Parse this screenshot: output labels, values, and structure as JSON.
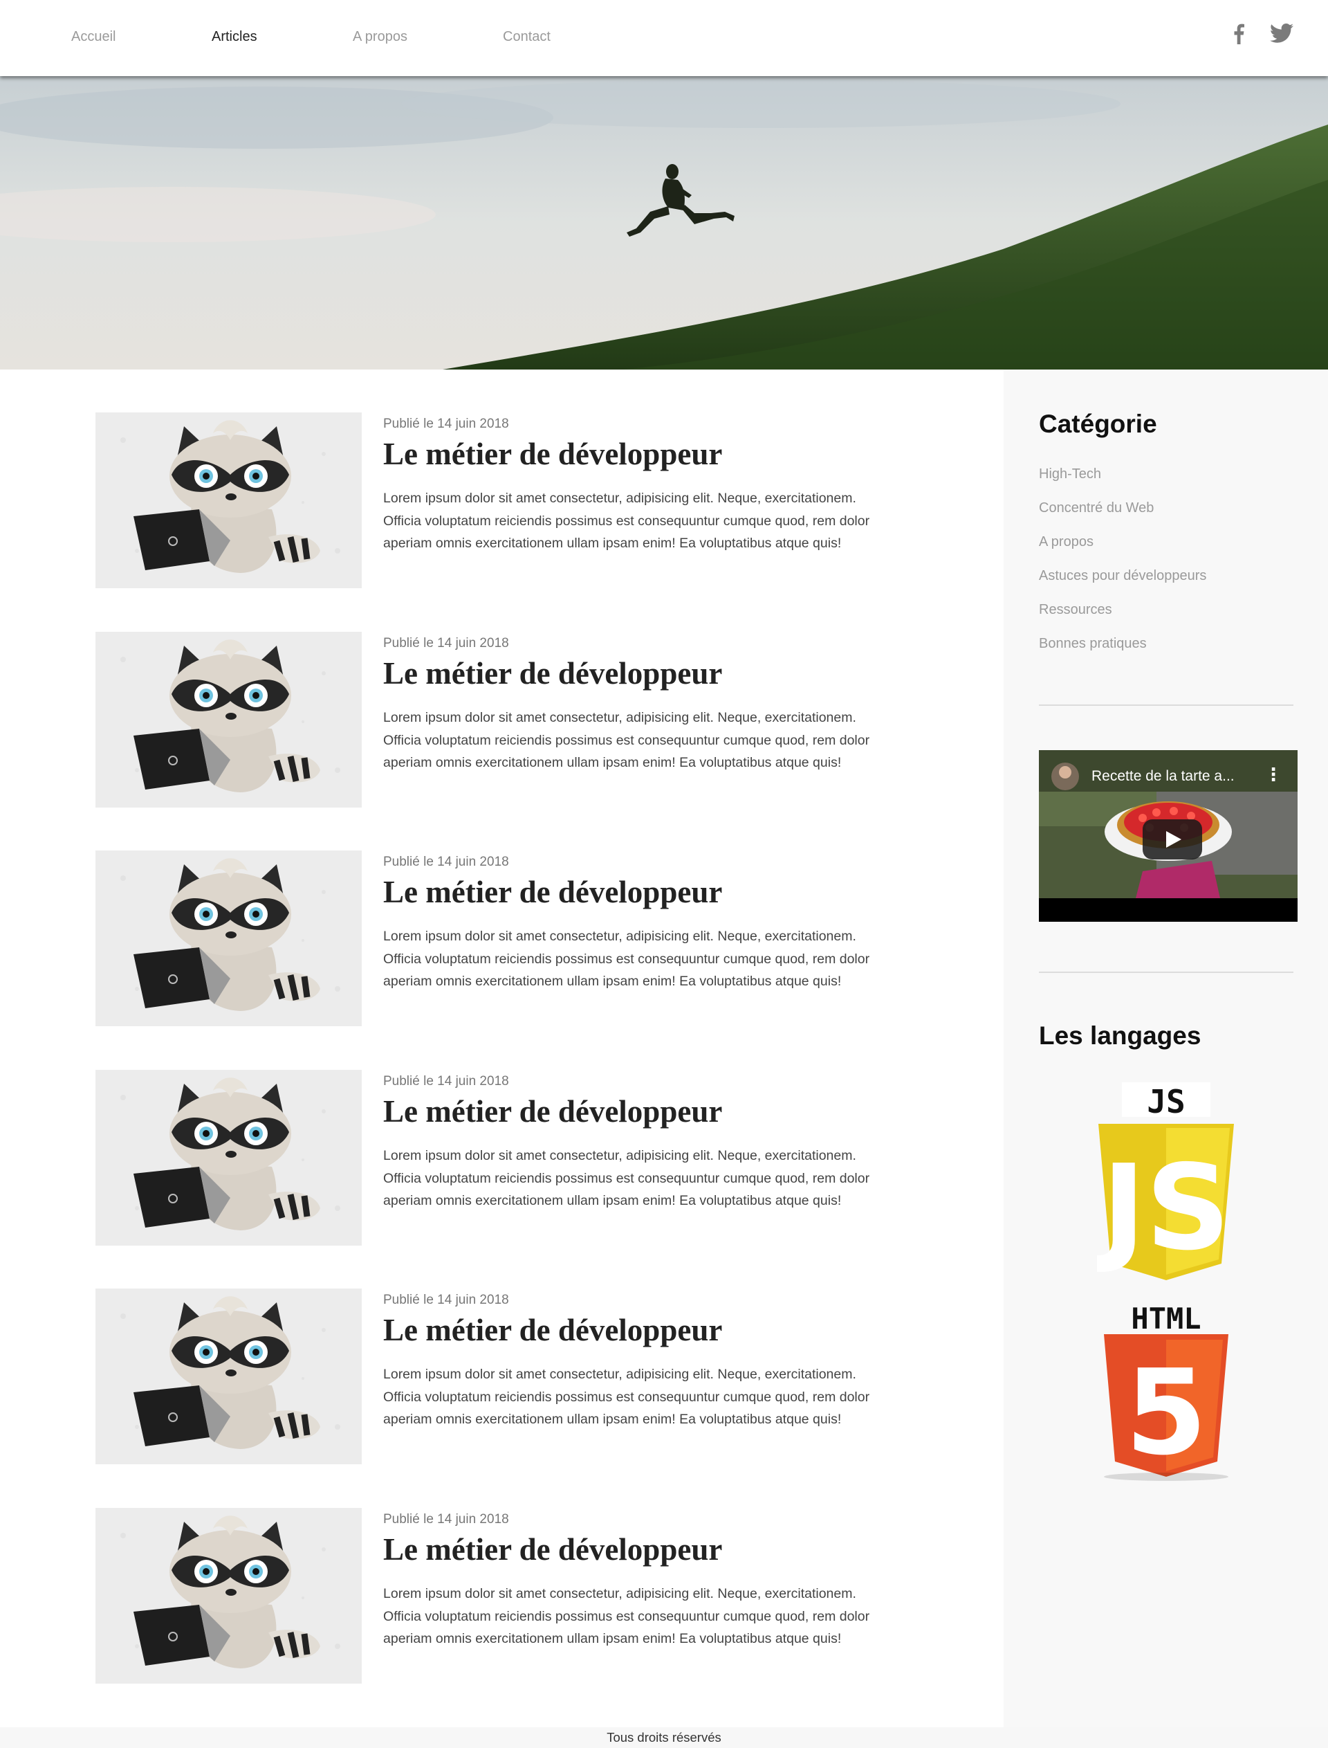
{
  "nav": {
    "items": [
      {
        "label": "Accueil",
        "active": false
      },
      {
        "label": "Articles",
        "active": true
      },
      {
        "label": "A propos",
        "active": false
      },
      {
        "label": "Contact",
        "active": false
      }
    ],
    "social": [
      "facebook-icon",
      "twitter-icon"
    ]
  },
  "hero": {
    "image": "person-jumping-on-grassy-hill"
  },
  "articles": [
    {
      "meta": "Publié le 14 juin 2018",
      "title": "Le métier de développeur",
      "lines": [
        "Lorem ipsum dolor sit amet consectetur, adipisicing elit. Neque, exercitationem.",
        "Officia voluptatum reiciendis possimus est consequuntur cumque quod, rem dolor",
        "aperiam omnis exercitationem ullam ipsam enim! Ea voluptatibus atque quis!"
      ]
    },
    {
      "meta": "Publié le 14 juin 2018",
      "title": "Le métier de développeur",
      "lines": [
        "Lorem ipsum dolor sit amet consectetur, adipisicing elit. Neque, exercitationem.",
        "Officia voluptatum reiciendis possimus est consequuntur cumque quod, rem dolor",
        "aperiam omnis exercitationem ullam ipsam enim! Ea voluptatibus atque quis!"
      ]
    },
    {
      "meta": "Publié le 14 juin 2018",
      "title": "Le métier de développeur",
      "lines": [
        "Lorem ipsum dolor sit amet consectetur, adipisicing elit. Neque, exercitationem.",
        "Officia voluptatum reiciendis possimus est consequuntur cumque quod, rem dolor",
        "aperiam omnis exercitationem ullam ipsam enim! Ea voluptatibus atque quis!"
      ]
    },
    {
      "meta": "Publié le 14 juin 2018",
      "title": "Le métier de développeur",
      "lines": [
        "Lorem ipsum dolor sit amet consectetur, adipisicing elit. Neque, exercitationem.",
        "Officia voluptatum reiciendis possimus est consequuntur cumque quod, rem dolor",
        "aperiam omnis exercitationem ullam ipsam enim! Ea voluptatibus atque quis!"
      ]
    },
    {
      "meta": "Publié le 14 juin 2018",
      "title": "Le métier de développeur",
      "lines": [
        "Lorem ipsum dolor sit amet consectetur, adipisicing elit. Neque, exercitationem.",
        "Officia voluptatum reiciendis possimus est consequuntur cumque quod, rem dolor",
        "aperiam omnis exercitationem ullam ipsam enim! Ea voluptatibus atque quis!"
      ]
    },
    {
      "meta": "Publié le 14 juin 2018",
      "title": "Le métier de développeur",
      "lines": [
        "Lorem ipsum dolor sit amet consectetur, adipisicing elit. Neque, exercitationem.",
        "Officia voluptatum reiciendis possimus est consequuntur cumque quod, rem dolor",
        "aperiam omnis exercitationem ullam ipsam enim! Ea voluptatibus atque quis!"
      ]
    }
  ],
  "sidebar": {
    "category_heading": "Catégorie",
    "categories": [
      "High-Tech",
      "Concentré du Web",
      "A propos",
      "Astuces pour développeurs",
      "Ressources",
      "Bonnes pratiques"
    ],
    "video": {
      "title": "Recette de la tarte a...",
      "menu": "⋮"
    },
    "languages_heading": "Les langages",
    "logos": [
      {
        "label": "JS",
        "badge": "JS",
        "color": "#f0d81f"
      },
      {
        "label": "HTML",
        "badge": "5",
        "color": "#e44d26"
      }
    ]
  },
  "footer": {
    "text": "Tous droits réservés"
  }
}
